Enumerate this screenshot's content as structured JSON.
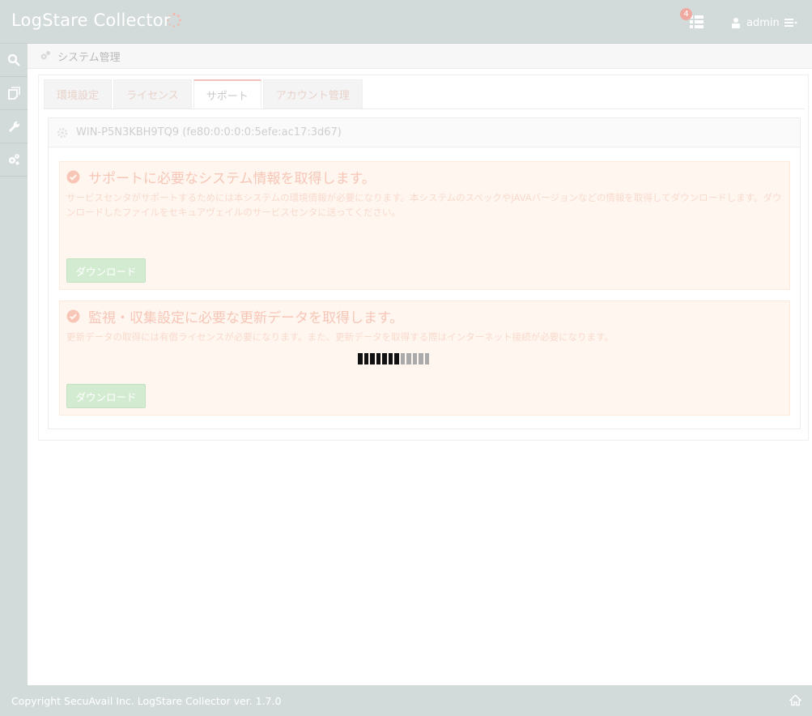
{
  "header": {
    "brand": "LogStare Collector",
    "tasks_badge": "4",
    "user_label": "admin"
  },
  "sidebar": {
    "items": [
      {
        "icon": "search-icon"
      },
      {
        "icon": "tags-icon"
      },
      {
        "icon": "wrench-icon"
      },
      {
        "icon": "gears-icon"
      }
    ]
  },
  "breadcrumb": {
    "label": "システム管理",
    "icon": "gears-icon"
  },
  "tabs": [
    {
      "label": "環境設定",
      "active": false
    },
    {
      "label": "ライセンス",
      "active": false
    },
    {
      "label": "サポート",
      "active": true
    },
    {
      "label": "アカウント管理",
      "active": false
    }
  ],
  "host": {
    "label": "WIN-P5N3KBH9TQ9 (fe80:0:0:0:0:5efe:ac17:3d67)"
  },
  "support": {
    "title": "サポートに必要なシステム情報を取得します。",
    "description": "サービスセンタがサポートするためには本システムの環境情報が必要になります。本システムのスペックやJAVAバージョンなどの情報を取得してダウンロードします。ダウンロードしたファイルをセキュアヴェイルのサービスセンタに送ってください。",
    "button_label": "ダウンロード"
  },
  "update": {
    "title": "監視・収集設定に必要な更新データを取得します。",
    "description": "更新データの取得には有償ライセンスが必要になります。また、更新データを取得する際はインターネット接続が必要になります。",
    "button_label": "ダウンロード",
    "progress_filled": 7,
    "progress_total": 12
  },
  "footer": {
    "copyright": "Copyright SecuAvail Inc. LogStare Collector ver. 1.7.0"
  },
  "colors": {
    "chrome": "#d3dbda",
    "alert_bg": "#fff6ef",
    "button": "#d3ecd1",
    "badge": "#f0a9a0"
  }
}
